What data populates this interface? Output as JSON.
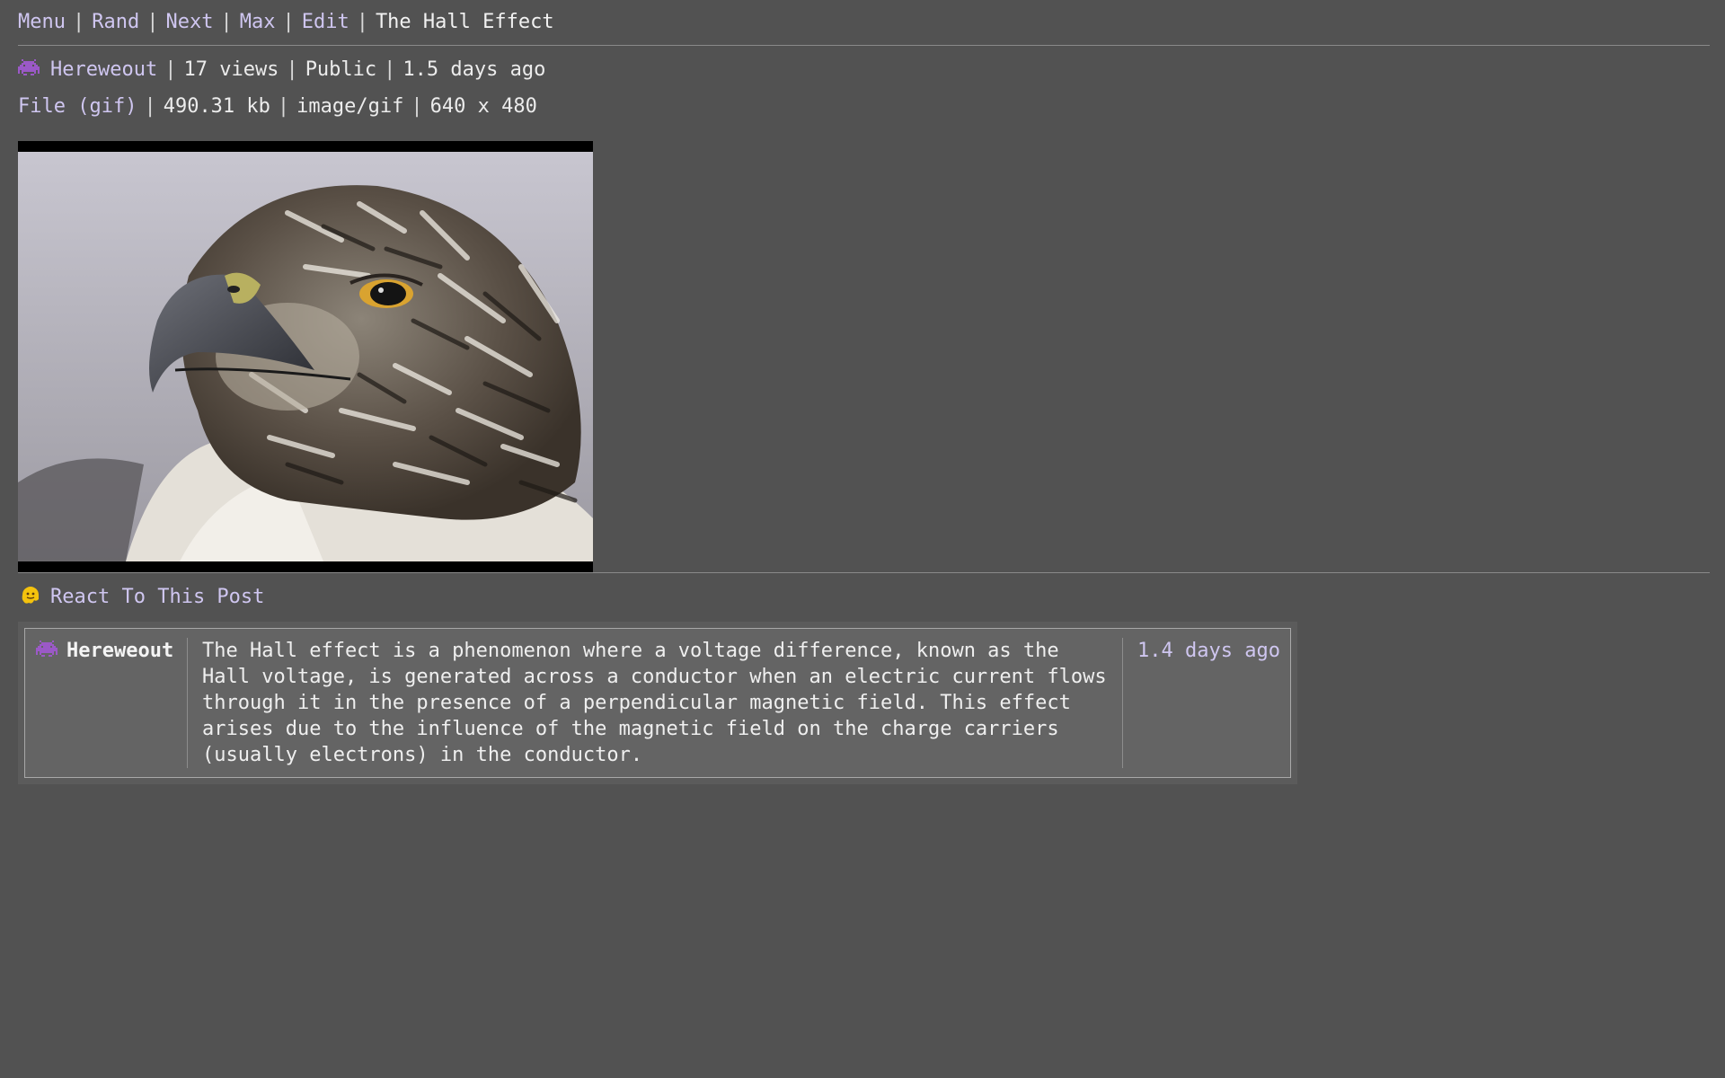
{
  "nav": {
    "items": [
      "Menu",
      "Rand",
      "Next",
      "Max",
      "Edit"
    ],
    "title": "The Hall Effect"
  },
  "post_meta": {
    "author": "Hereweout",
    "views": "17 views",
    "visibility": "Public",
    "age": "1.5 days ago",
    "author_icon": "alien-monster-icon"
  },
  "file_meta": {
    "file_link": "File (gif)",
    "size": "490.31 kb",
    "mime": "image/gif",
    "dimensions": "640 x 480"
  },
  "image": {
    "subject": "hawk-head-photo"
  },
  "react": {
    "label": "React To This Post",
    "icon": "melting-face-icon"
  },
  "comments": [
    {
      "author": "Hereweout",
      "author_icon": "alien-monster-icon",
      "text": "The Hall effect is a phenomenon where a voltage difference, known as the Hall voltage, is generated across a conductor when an electric current flows through it in the presence of a perpendicular magnetic field. This effect arises due to the influence of the magnetic field on the charge carriers (usually electrons) in the conductor.",
      "time": "1.4 days ago"
    }
  ],
  "colors": {
    "background": "#525252",
    "link": "#cfc6f0",
    "text": "#ececec"
  }
}
